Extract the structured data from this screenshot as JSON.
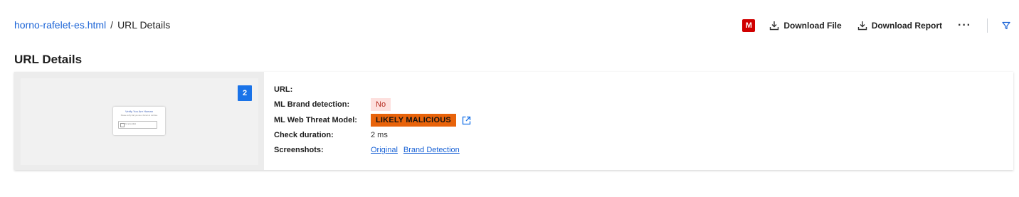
{
  "breadcrumb": {
    "link": "horno-rafelet-es.html",
    "separator": "/",
    "current": "URL Details"
  },
  "header": {
    "badge": "M",
    "download_file": "Download File",
    "download_report": "Download Report",
    "more": "···"
  },
  "page_title": "URL Details",
  "screenshot": {
    "count": "2",
    "dialog_title": "Verify You Are Human",
    "dialog_subtitle": "Please verify that you are a human to continue",
    "checkbox_label": "I'm not a robot"
  },
  "details": {
    "url_label": "URL:",
    "url_value": "",
    "brand_label": "ML Brand detection:",
    "brand_value": "No",
    "threat_label": "ML Web Threat Model:",
    "threat_value": "LIKELY MALICIOUS",
    "duration_label": "Check duration:",
    "duration_value": "2 ms",
    "screenshots_label": "Screenshots:",
    "screenshots_links": [
      "Original",
      "Brand Detection"
    ]
  },
  "colors": {
    "accent": "#1a73e8",
    "badge_red": "#d00000",
    "malicious": "#e8630a",
    "no_bg": "#fde0de"
  }
}
